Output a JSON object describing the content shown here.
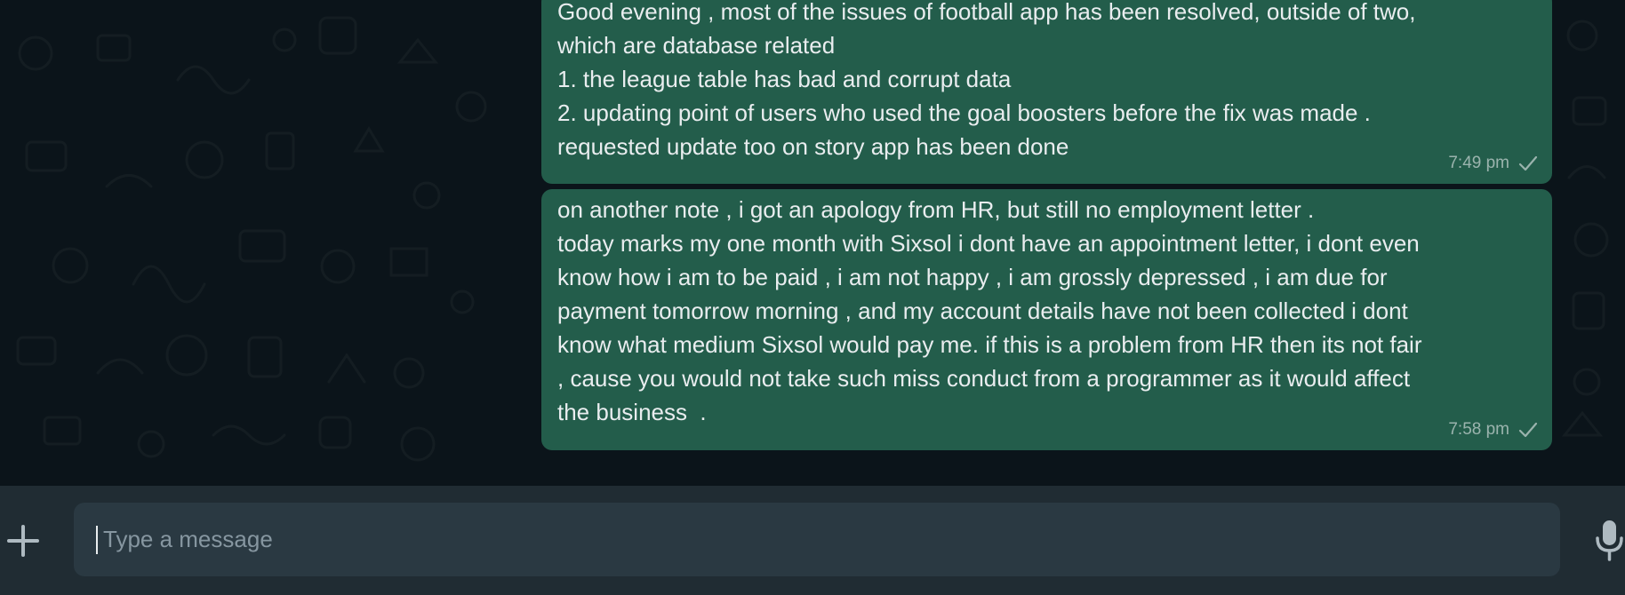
{
  "messages": [
    {
      "lines": [
        "Good evening , most of the issues of football app has been resolved, outside of two,",
        "which are database related",
        "1. the league table has bad and corrupt data",
        "2. updating point of users who used the goal boosters before the fix was made .",
        "requested update too on story app has been done"
      ],
      "time": "7:49 pm",
      "status_icon": "single-check-icon"
    },
    {
      "lines": [
        "on another note , i got an apology from HR, but still no employment letter .",
        "today marks my one month with Sixsol i dont have an appointment letter, i dont even",
        "know how i am to be paid , i am not happy , i am grossly depressed , i am due for",
        "payment tomorrow morning , and my account details have not been collected i dont",
        "know what medium Sixsol would pay me. if this is a problem from HR then its not fair",
        ", cause you would not take such miss conduct from a programmer as it would affect",
        "the business  ."
      ],
      "time": "7:58 pm",
      "status_icon": "single-check-icon"
    }
  ],
  "composer": {
    "placeholder": "Type a message",
    "attach_icon": "plus-icon",
    "voice_icon": "microphone-icon"
  },
  "colors": {
    "chat_background": "#0b141a",
    "outgoing_bubble": "#235d4b",
    "footer_background": "#202c33",
    "input_background": "#2a3942",
    "text": "#e9edef",
    "muted_text": "#8696a0"
  }
}
